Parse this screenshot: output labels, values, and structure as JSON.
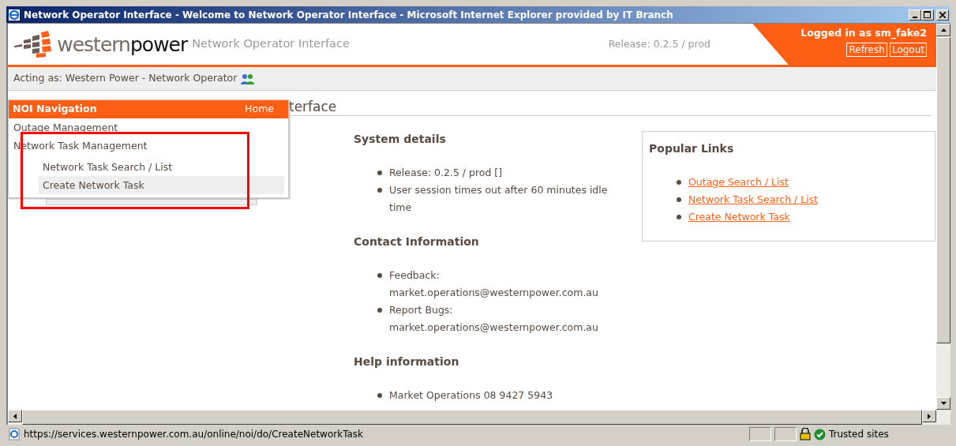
{
  "window": {
    "title": "Network Operator Interface - Welcome to Network Operator Interface - Microsoft Internet Explorer provided by IT Branch"
  },
  "header": {
    "logo_text": [
      "western",
      "power"
    ],
    "app_name": "Network Operator Interface",
    "release": "Release: 0.2.5 / prod",
    "user": "Logged in as sm_fake2",
    "buttons": [
      "Refresh",
      "Logout"
    ]
  },
  "acting_as": "Acting as: Western Power - Network Operator",
  "nav_menu": {
    "title": "NOI Navigation",
    "home": "Home",
    "items": [
      {
        "label": "Outage Management"
      },
      {
        "label": "Network Task Management",
        "children": [
          {
            "label": "Network Task Search / List",
            "selected": false
          },
          {
            "label": "Create Network Task",
            "selected": true
          }
        ]
      }
    ]
  },
  "page_heading": "terface",
  "sections": [
    {
      "title": "System details",
      "items": [
        "Release: 0.2.5 / prod []",
        "User session times out after 60 minutes idle time"
      ]
    },
    {
      "title": "Contact Information",
      "items": [
        "Feedback: market.operations@westernpower.com.au",
        "Report Bugs: market.operations@westernpower.com.au"
      ]
    },
    {
      "title": "Help information",
      "items": [
        "Market Operations 08 9427 5943"
      ]
    }
  ],
  "popular_links": {
    "title": "Popular Links",
    "links": [
      "Outage Search / List",
      "Network Task Search / List",
      "Create Network Task"
    ]
  },
  "status_bar": {
    "url": "https://services.westernpower.com.au/online/noi/do/CreateNetworkTask",
    "zone": "Trusted sites"
  }
}
